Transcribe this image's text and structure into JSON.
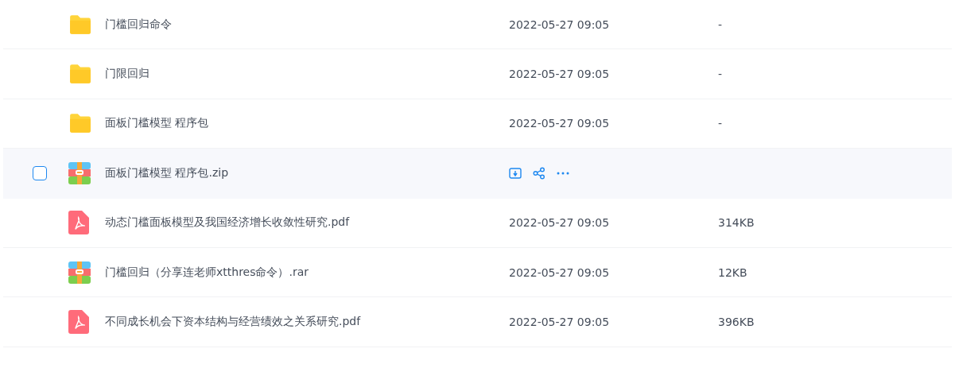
{
  "files": [
    {
      "kind": "folder",
      "name": "门槛回归命令",
      "date": "2022-05-27 09:05",
      "size": "-",
      "hovered": false,
      "checked": false
    },
    {
      "kind": "folder",
      "name": "门限回归",
      "date": "2022-05-27 09:05",
      "size": "-",
      "hovered": false,
      "checked": false
    },
    {
      "kind": "folder",
      "name": "面板门槛模型 程序包",
      "date": "2022-05-27 09:05",
      "size": "-",
      "hovered": false,
      "checked": false
    },
    {
      "kind": "archive",
      "name": "面板门槛模型 程序包.zip",
      "hovered": true,
      "checked": false
    },
    {
      "kind": "pdf",
      "name": "动态门槛面板模型及我国经济增长收敛性研究.pdf",
      "date": "2022-05-27 09:05",
      "size": "314KB",
      "hovered": false,
      "checked": false
    },
    {
      "kind": "archive",
      "name": "门槛回归（分享连老师xtthres命令）.rar",
      "date": "2022-05-27 09:05",
      "size": "12KB",
      "hovered": false,
      "checked": false
    },
    {
      "kind": "pdf",
      "name": "不同成长机会下资本结构与经营绩效之关系研究.pdf",
      "date": "2022-05-27 09:05",
      "size": "396KB",
      "hovered": false,
      "checked": false
    }
  ]
}
